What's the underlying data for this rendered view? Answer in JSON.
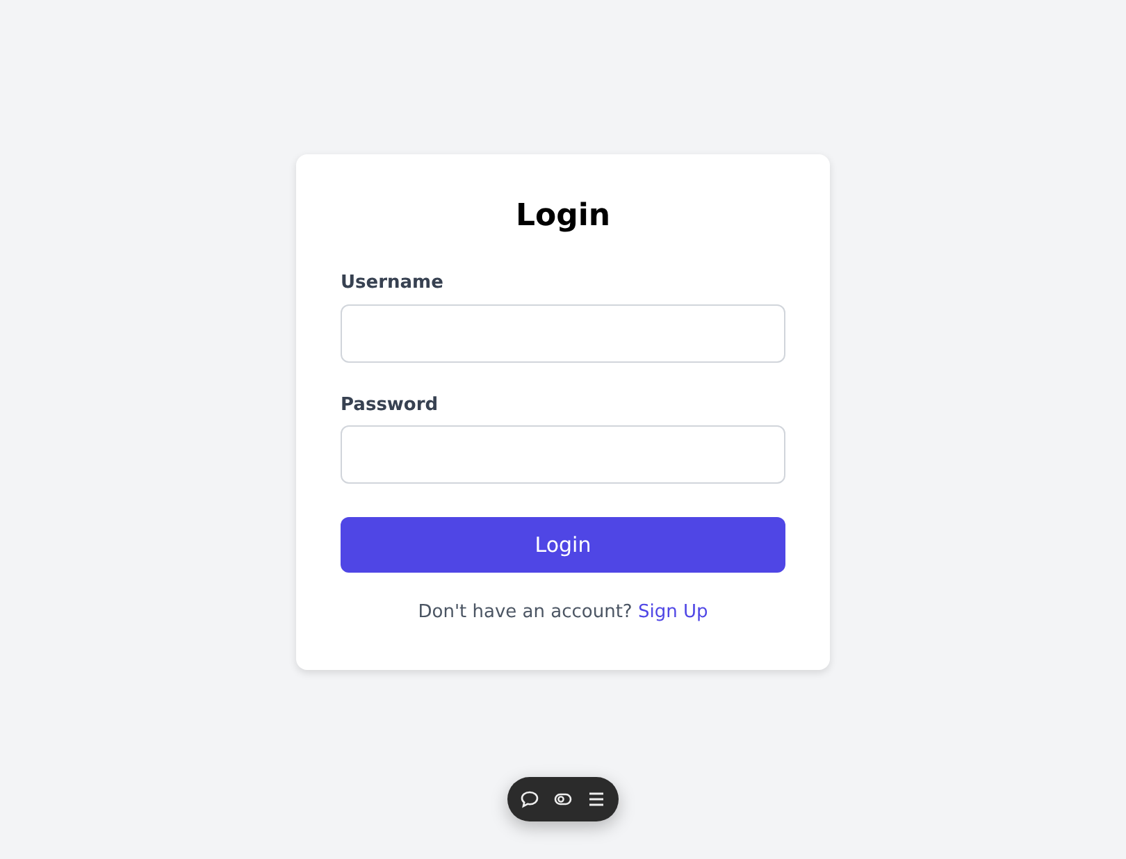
{
  "form": {
    "title": "Login",
    "fields": [
      {
        "label": "Username"
      },
      {
        "label": "Password"
      }
    ],
    "submit": "Login",
    "footer": {
      "text": "Don't have an account?",
      "link": "Sign Up"
    }
  },
  "toolbar": {
    "items": [
      {
        "kind": "comment"
      },
      {
        "kind": "toggle"
      },
      {
        "kind": "menu"
      }
    ]
  }
}
